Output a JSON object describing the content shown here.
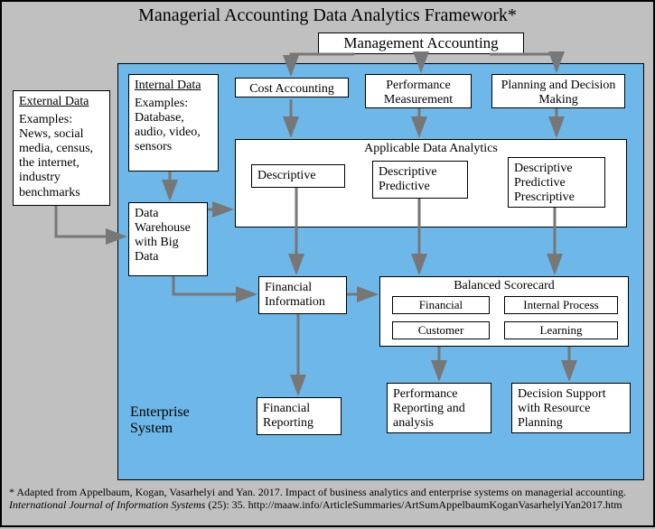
{
  "title": "Managerial Accounting Data Analytics Framework*",
  "enterprise_label1": "Enterprise",
  "enterprise_label2": "System",
  "external": {
    "header": "External Data",
    "body": "Examples: News, social media, census, the internet, industry benchmarks"
  },
  "internal": {
    "header": "Internal Data",
    "body": "Examples: Database, audio, video, sensors"
  },
  "warehouse": "Data Warehouse with Big Data",
  "mgmt": "Management Accounting",
  "cost": "Cost Accounting",
  "perf_meas": "Performance Measurement",
  "planning": "Planning and Decision Making",
  "ada": {
    "title": "Applicable Data Analytics",
    "a": "Descriptive",
    "b": "Descriptive Predictive",
    "c": "Descriptive Predictive Prescriptive"
  },
  "fin_info": "Financial Information",
  "fin_rep": "Financial Reporting",
  "bsc": {
    "title": "Balanced Scorecard",
    "fin": "Financial",
    "ip": "Internal Process",
    "cust": "Customer",
    "learn": "Learning"
  },
  "perf_rep": "Performance Reporting and analysis",
  "dec_sup": "Decision Support with Resource Planning",
  "footnote_pre": "* Adapted from Appelbaum, Kogan, Vasarhelyi and Yan.  2017.  Impact of business analytics and enterprise systems on managerial accounting.  ",
  "footnote_ital": "International Journal of Information Systems",
  "footnote_post": " (25): 35. http://maaw.info/ArticleSummaries/ArtSumAppelbaumKoganVasarhelyiYan2017.htm"
}
